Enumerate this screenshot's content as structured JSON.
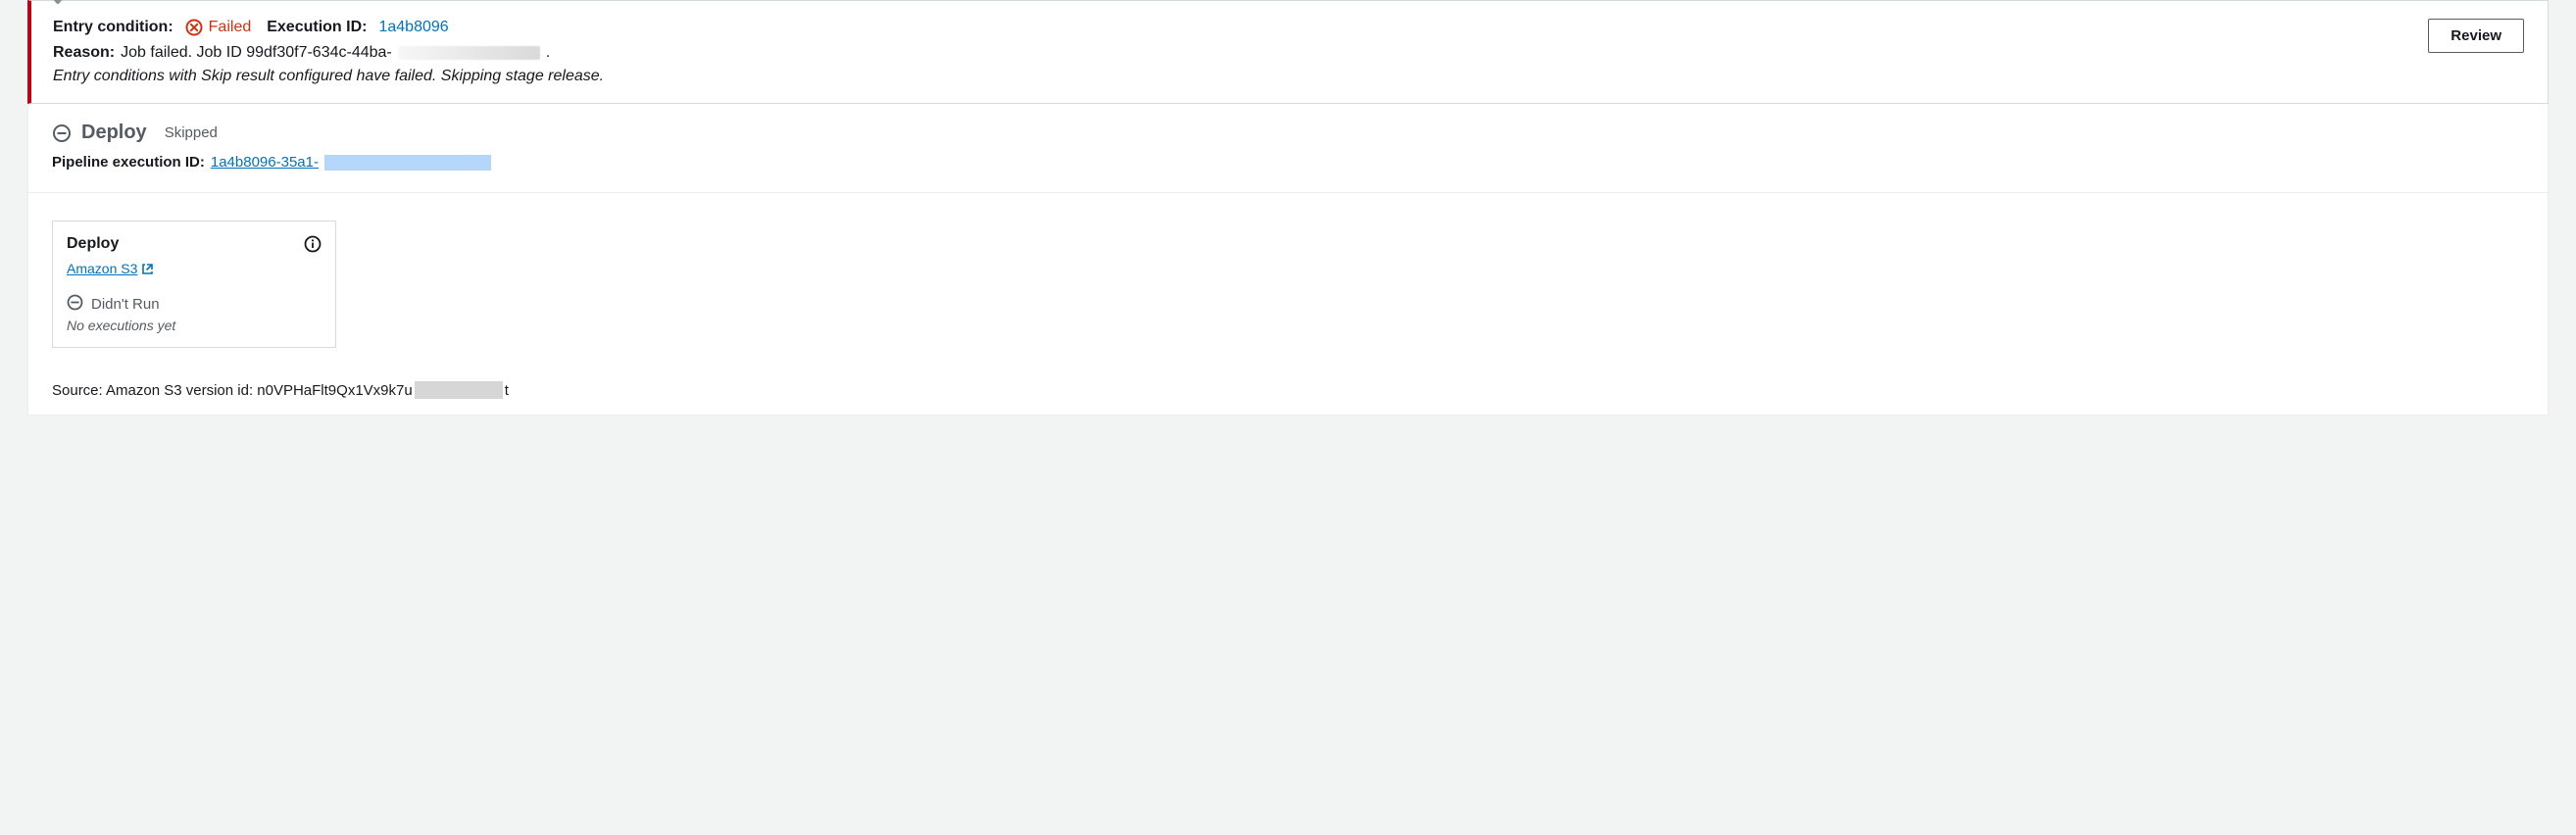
{
  "condition": {
    "entry_condition_label": "Entry condition:",
    "status_text": "Failed",
    "execution_id_label": "Execution ID:",
    "execution_id": "1a4b8096",
    "reason_label": "Reason:",
    "reason_text": "Job failed. Job ID 99df30f7-634c-44ba-",
    "reason_suffix": ".",
    "skip_note": "Entry conditions with Skip result configured have failed. Skipping stage release.",
    "review_button": "Review"
  },
  "stage": {
    "name": "Deploy",
    "status": "Skipped",
    "pipeline_exec_label": "Pipeline execution ID:",
    "pipeline_exec_id": "1a4b8096-35a1-"
  },
  "action": {
    "name": "Deploy",
    "provider": "Amazon S3",
    "status": "Didn't Run",
    "no_exec": "No executions yet"
  },
  "source": {
    "prefix": "Source: Amazon S3 version id: n0VPHaFlt9Qx1Vx9k7u",
    "suffix": "t"
  }
}
